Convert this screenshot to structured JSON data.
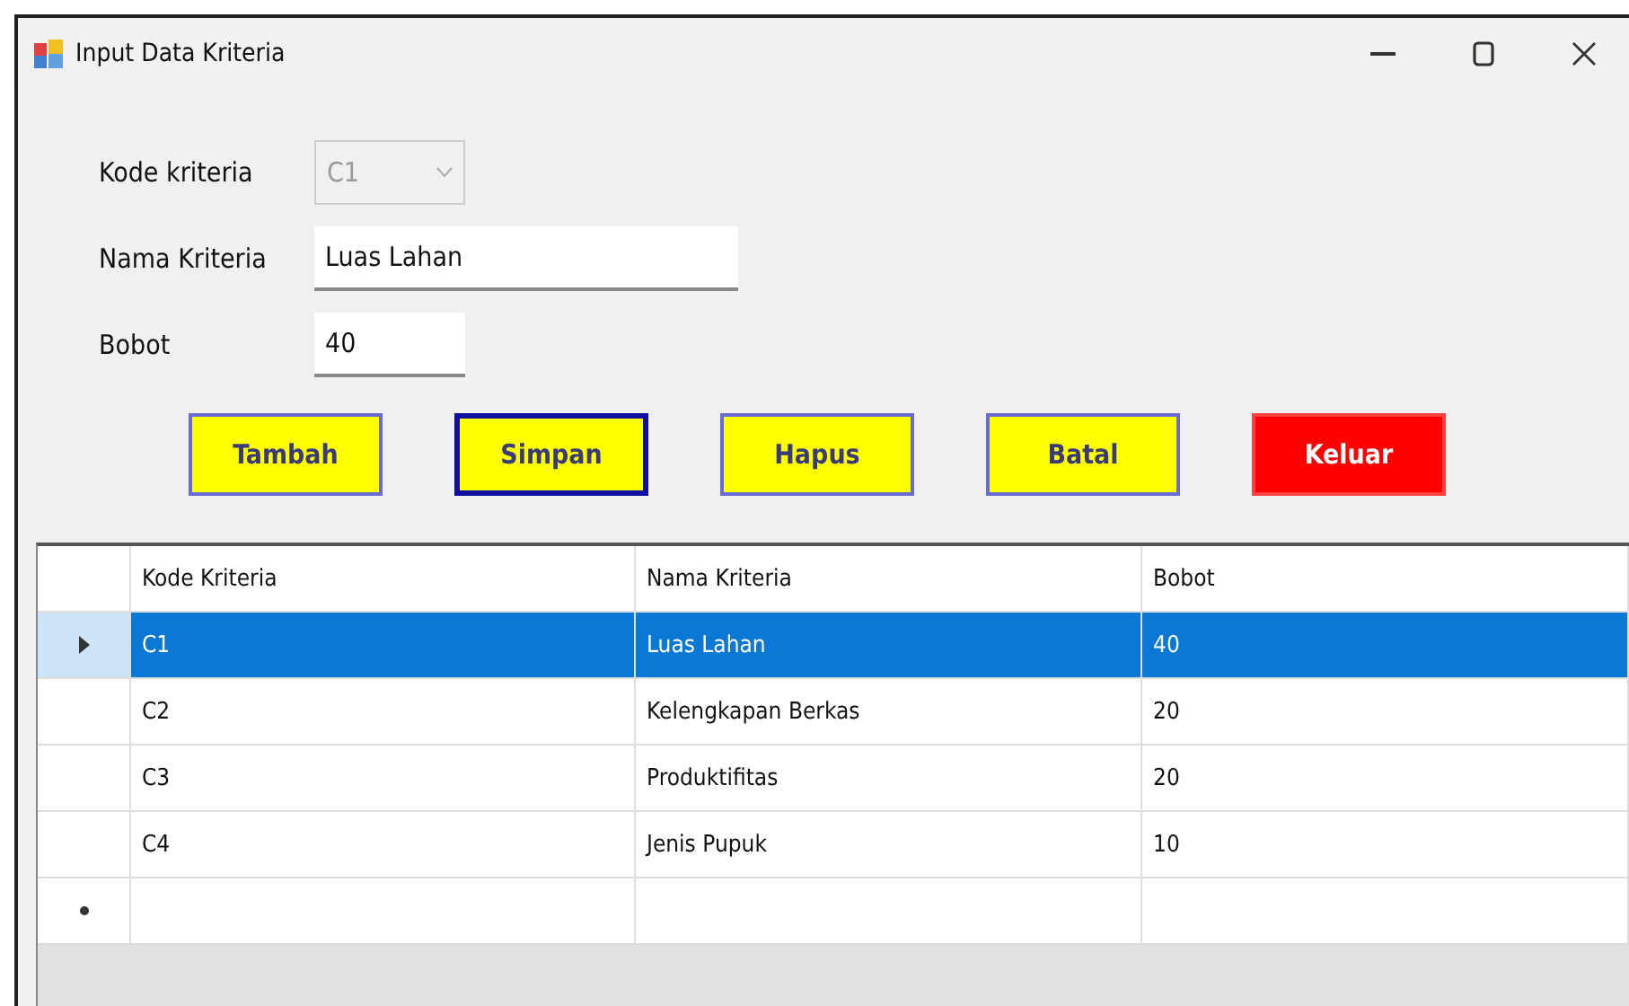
{
  "window": {
    "title": "Input Data Kriteria"
  },
  "fields": [
    {
      "label": "Kode kriteria",
      "kind": "combo",
      "value": "C1",
      "disabled": true
    },
    {
      "label": "Nama Kriteria",
      "kind": "text",
      "value": "Luas Lahan",
      "disabled": false
    },
    {
      "label": "Bobot",
      "kind": "number",
      "value": "40",
      "disabled": false
    }
  ],
  "buttons": [
    {
      "label": "Tambah",
      "kind": "normal",
      "focused": false
    },
    {
      "label": "Simpan",
      "kind": "normal",
      "focused": true
    },
    {
      "label": "Hapus",
      "kind": "normal",
      "focused": false
    },
    {
      "label": "Batal",
      "kind": "normal",
      "focused": false
    },
    {
      "label": "Keluar",
      "kind": "danger",
      "focused": false
    }
  ],
  "table": {
    "columns": [
      "Kode Kriteria",
      "Nama Kriteria",
      "Bobot"
    ],
    "rows": [
      {
        "cells": [
          "C1",
          "Luas Lahan",
          "40"
        ],
        "selected": true
      },
      {
        "cells": [
          "C2",
          "Kelengkapan Berkas",
          "20"
        ],
        "selected": false
      },
      {
        "cells": [
          "C3",
          "Produktifitas",
          "20"
        ],
        "selected": false
      },
      {
        "cells": [
          "C4",
          "Jenis Pupuk",
          "10"
        ],
        "selected": false
      }
    ],
    "new_row": true
  }
}
